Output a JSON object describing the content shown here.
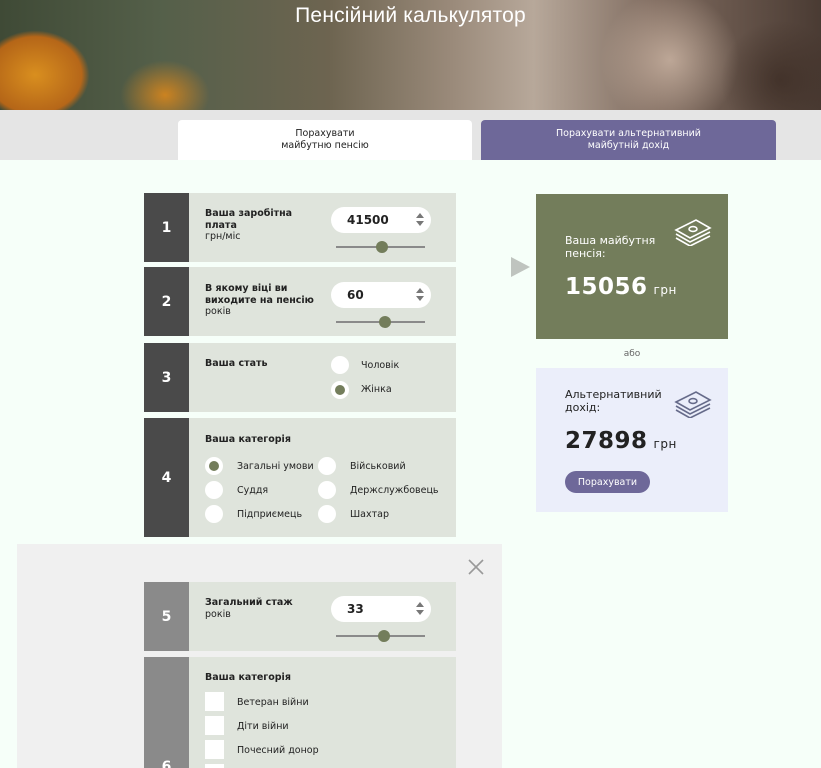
{
  "header": {
    "title": "Пенсійний калькулятор"
  },
  "tabs": [
    {
      "label_line1": "Порахувати",
      "label_line2": "майбутню пенсію"
    },
    {
      "label_line1": "Порахувати альтернативний",
      "label_line2": "майбутній дохід"
    }
  ],
  "steps": {
    "s1": {
      "num": "1",
      "label": "Ваша заробітна плата",
      "sub": "грн/міс",
      "value": "41500",
      "slider_fraction": 0.52
    },
    "s2": {
      "num": "2",
      "label": "В якому віці ви виходите на пенсію",
      "sub": "років",
      "value": "60",
      "slider_fraction": 0.55
    },
    "s3": {
      "num": "3",
      "label": "Ваша стать",
      "options": [
        "Чоловік",
        "Жінка"
      ],
      "selected": "Жінка"
    },
    "s4": {
      "num": "4",
      "label": "Ваша категорія",
      "options": [
        "Загальні умови",
        "Військовий",
        "Суддя",
        "Держслужбовець",
        "Підприємець",
        "Шахтар"
      ],
      "selected": "Загальні умови"
    },
    "s5": {
      "num": "5",
      "label": "Загальний стаж",
      "sub": "років",
      "value": "33",
      "slider_fraction": 0.54
    },
    "s6": {
      "num": "6",
      "label": "Ваша категорія",
      "options": [
        "Ветеран війни",
        "Діти війни",
        "Почесний донор"
      ]
    }
  },
  "result": {
    "pension_label": "Ваша майбутня пенсія:",
    "pension_value": "15056",
    "unit": "грн",
    "or": "або",
    "alt_label": "Альтернативний дохід:",
    "alt_value": "27898",
    "calc_button": "Порахувати"
  },
  "colors": {
    "accent_green": "#737d5b",
    "accent_purple": "#6e6899",
    "step_bg": "#dfe4dc"
  },
  "icons": [
    "money-stack-icon",
    "close-icon",
    "play-arrow-icon"
  ]
}
